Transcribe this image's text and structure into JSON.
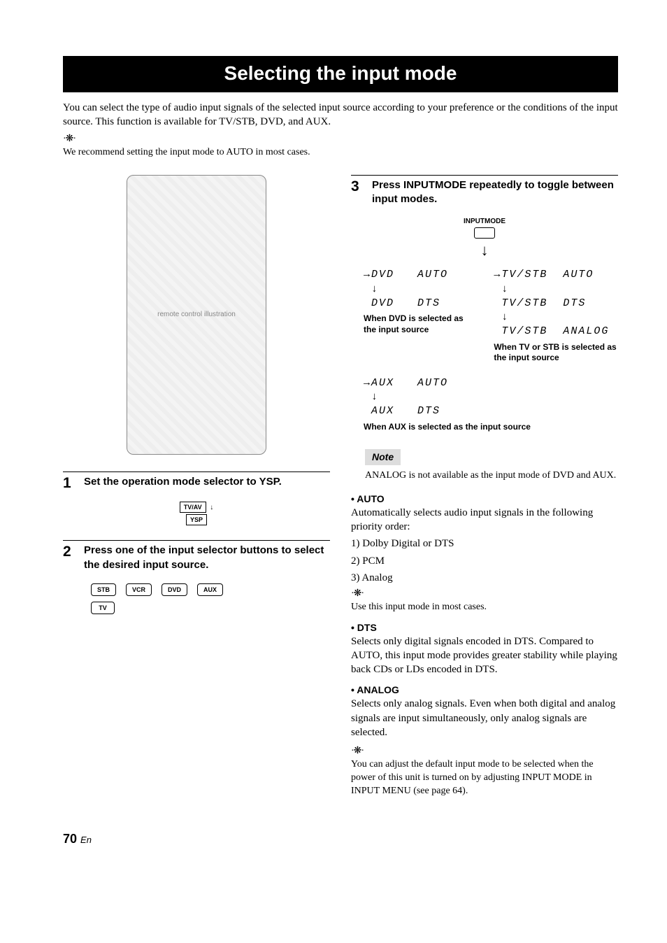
{
  "title": "Selecting the input mode",
  "intro": "You can select the type of audio input signals of the selected input source according to your preference or the conditions of the input source. This function is available for TV/STB, DVD, and AUX.",
  "top_tip": "We recommend setting the input mode to AUTO in most cases.",
  "remote": {
    "placeholder": "remote control illustration"
  },
  "step1": {
    "num": "1",
    "text": "Set the operation mode selector to YSP.",
    "switch_top": "TV/AV",
    "switch_bottom": "YSP"
  },
  "step2": {
    "num": "2",
    "text": "Press one of the input selector buttons to select the desired input source.",
    "buttons": [
      "STB",
      "VCR",
      "DVD",
      "AUX",
      "TV"
    ]
  },
  "step3": {
    "num": "3",
    "text": "Press INPUTMODE repeatedly to toggle between input modes.",
    "inputmode_label": "INPUTMODE",
    "dvd_lines": "→DVD   AUTO\n ↓\n DVD   DTS",
    "dvd_caption": "When DVD is selected as the input source",
    "tvstb_lines": "→TV/STB  AUTO\n ↓\n TV/STB  DTS\n ↓\n TV/STB  ANALOG",
    "tvstb_caption": "When TV or STB is selected as the input source",
    "aux_lines": "→AUX   AUTO\n ↓\n AUX   DTS",
    "aux_caption": "When AUX is selected as the input source"
  },
  "note": {
    "label": "Note",
    "text": "ANALOG is not available as the input mode of DVD and AUX."
  },
  "modes": {
    "auto": {
      "head": "•  AUTO",
      "body": "Automatically selects audio input signals in the following priority order:",
      "p1": "1) Dolby Digital or DTS",
      "p2": "2) PCM",
      "p3": "3) Analog",
      "tip": "Use this input mode in most cases."
    },
    "dts": {
      "head": "•  DTS",
      "body": "Selects only digital signals encoded in DTS. Compared to AUTO, this input mode provides greater stability while playing back CDs or LDs encoded in DTS."
    },
    "analog": {
      "head": "•  ANALOG",
      "body": "Selects only analog signals. Even when both digital and analog signals are input simultaneously, only analog signals are selected."
    },
    "final_tip": "You can adjust the default input mode to be selected when the power of this unit is turned on by adjusting INPUT MODE in INPUT MENU (see page 64)."
  },
  "page": {
    "num": "70",
    "suffix": "En"
  }
}
